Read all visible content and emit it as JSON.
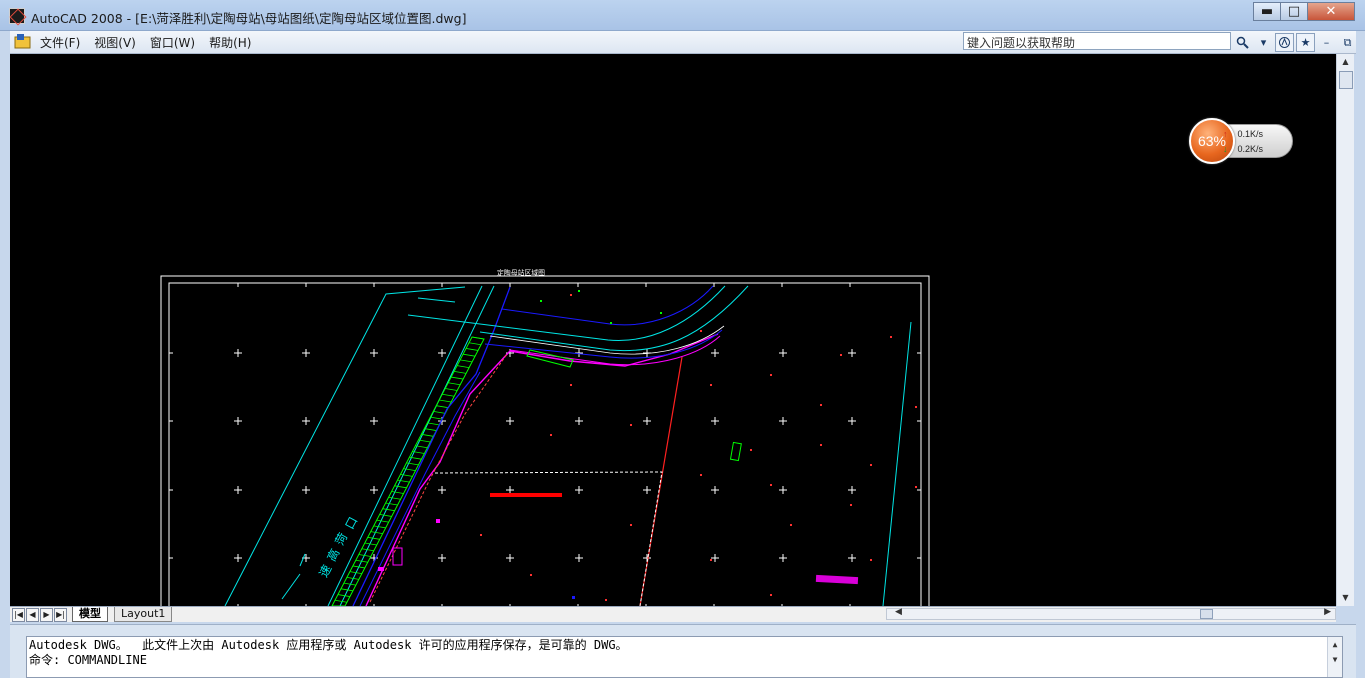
{
  "window": {
    "title": "AutoCAD 2008 - [E:\\菏泽胜利\\定陶母站\\母站图纸\\定陶母站区域位置图.dwg]",
    "minimize_label": "▬",
    "maximize_label": "□",
    "close_label": "✕"
  },
  "menubar": {
    "items": [
      "文件(F)",
      "视图(V)",
      "窗口(W)",
      "帮助(H)"
    ],
    "help_search_value": "键入问题以获取帮助",
    "doc_min_label": "–",
    "doc_restore_label": "⧉",
    "doc_close_label": "✕"
  },
  "drawing": {
    "road_label_glyphs": [
      "口",
      "菏",
      "高",
      "速"
    ],
    "sheet_title": "定陶母站区域图"
  },
  "net_widget": {
    "percent": "63%",
    "upload": "0.1K/s",
    "download": "0.2K/s"
  },
  "tabs": {
    "model": "模型",
    "layout1": "Layout1"
  },
  "command": {
    "line1": "Autodesk DWG。  此文件上次由 Autodesk 应用程序或 Autodesk 许可的应用程序保存，是可靠的 DWG。",
    "line2": "命令: COMMANDLINE"
  },
  "colors": {
    "canvas": "#000000",
    "cyan": "#00e5e5",
    "blue": "#1a1aff",
    "green": "#00ff00",
    "magenta": "#ff00ff",
    "red": "#ff0000",
    "white": "#ffffff"
  }
}
